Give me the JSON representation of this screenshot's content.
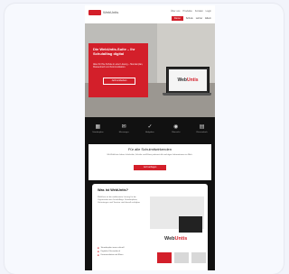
{
  "header": {
    "logo_text": "WebUntis",
    "topnav": [
      "Über uns",
      "Produkte",
      "Kontakt",
      "Login"
    ],
    "subnav_highlight": "Demo",
    "subnav": [
      "Schule",
      "Lehrer",
      "Eltern"
    ]
  },
  "hero": {
    "title": "Die WebUntis-Suite – Ihr Schulalltag digital",
    "text": "Alles für Ihre Schule in einer Lösung – Stundenplan, Klassenbuch und Kommunikation.",
    "button": "Jetzt entdecken",
    "laptop_brand_a": "Web",
    "laptop_brand_b": "Untis"
  },
  "icon_bar": [
    {
      "icon": "calendar-icon",
      "glyph": "▦",
      "label": "Stundenplan"
    },
    {
      "icon": "chat-icon",
      "glyph": "✉",
      "label": "Messenger"
    },
    {
      "icon": "check-icon",
      "glyph": "✓",
      "label": "Aufgaben"
    },
    {
      "icon": "eye-icon",
      "glyph": "◉",
      "label": "Übersicht"
    },
    {
      "icon": "bookmark-icon",
      "glyph": "▤",
      "label": "Klassenbuch"
    }
  ],
  "panel1": {
    "title": "Für alle Schulmitwirkenden",
    "text": "Mit WebUntis haben Lehrkräfte, Schüler und Eltern jederzeit alle wichtigen Informationen im Blick.",
    "button": "Jetzt anfragen"
  },
  "panel2": {
    "title": "Was ist WebUntis?",
    "text": "WebUntis ist die webbasierte Lösung für die Organisation des Schulalltags. Stundenpläne, Vertretungen und Termine sind überall verfügbar.",
    "logo_a": "Web",
    "logo_b": "Untis",
    "list": [
      "Stundenplan immer aktuell",
      "Digitales Klassenbuch",
      "Kommunikation mit Eltern"
    ]
  }
}
